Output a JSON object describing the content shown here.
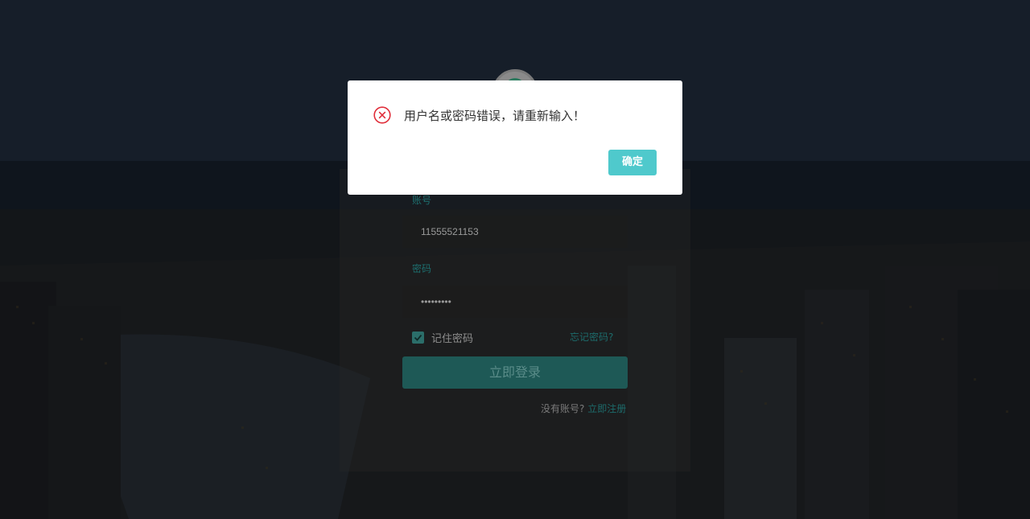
{
  "login": {
    "account_label": "账号",
    "account_value": "11555521153",
    "password_label": "密码",
    "password_value": "•••••••••",
    "remember_label": "记住密码",
    "forgot_link": "忘记密码?",
    "login_button": "立即登录",
    "no_account_text": "没有账号?",
    "register_link": "立即注册",
    "remember_checked": true
  },
  "dialog": {
    "message": "用户名或密码错误，请重新输入！",
    "ok_label": "确定",
    "icon": "error-circle-icon"
  },
  "colors": {
    "accent": "#4fc9cc",
    "error": "#e02e3a"
  }
}
